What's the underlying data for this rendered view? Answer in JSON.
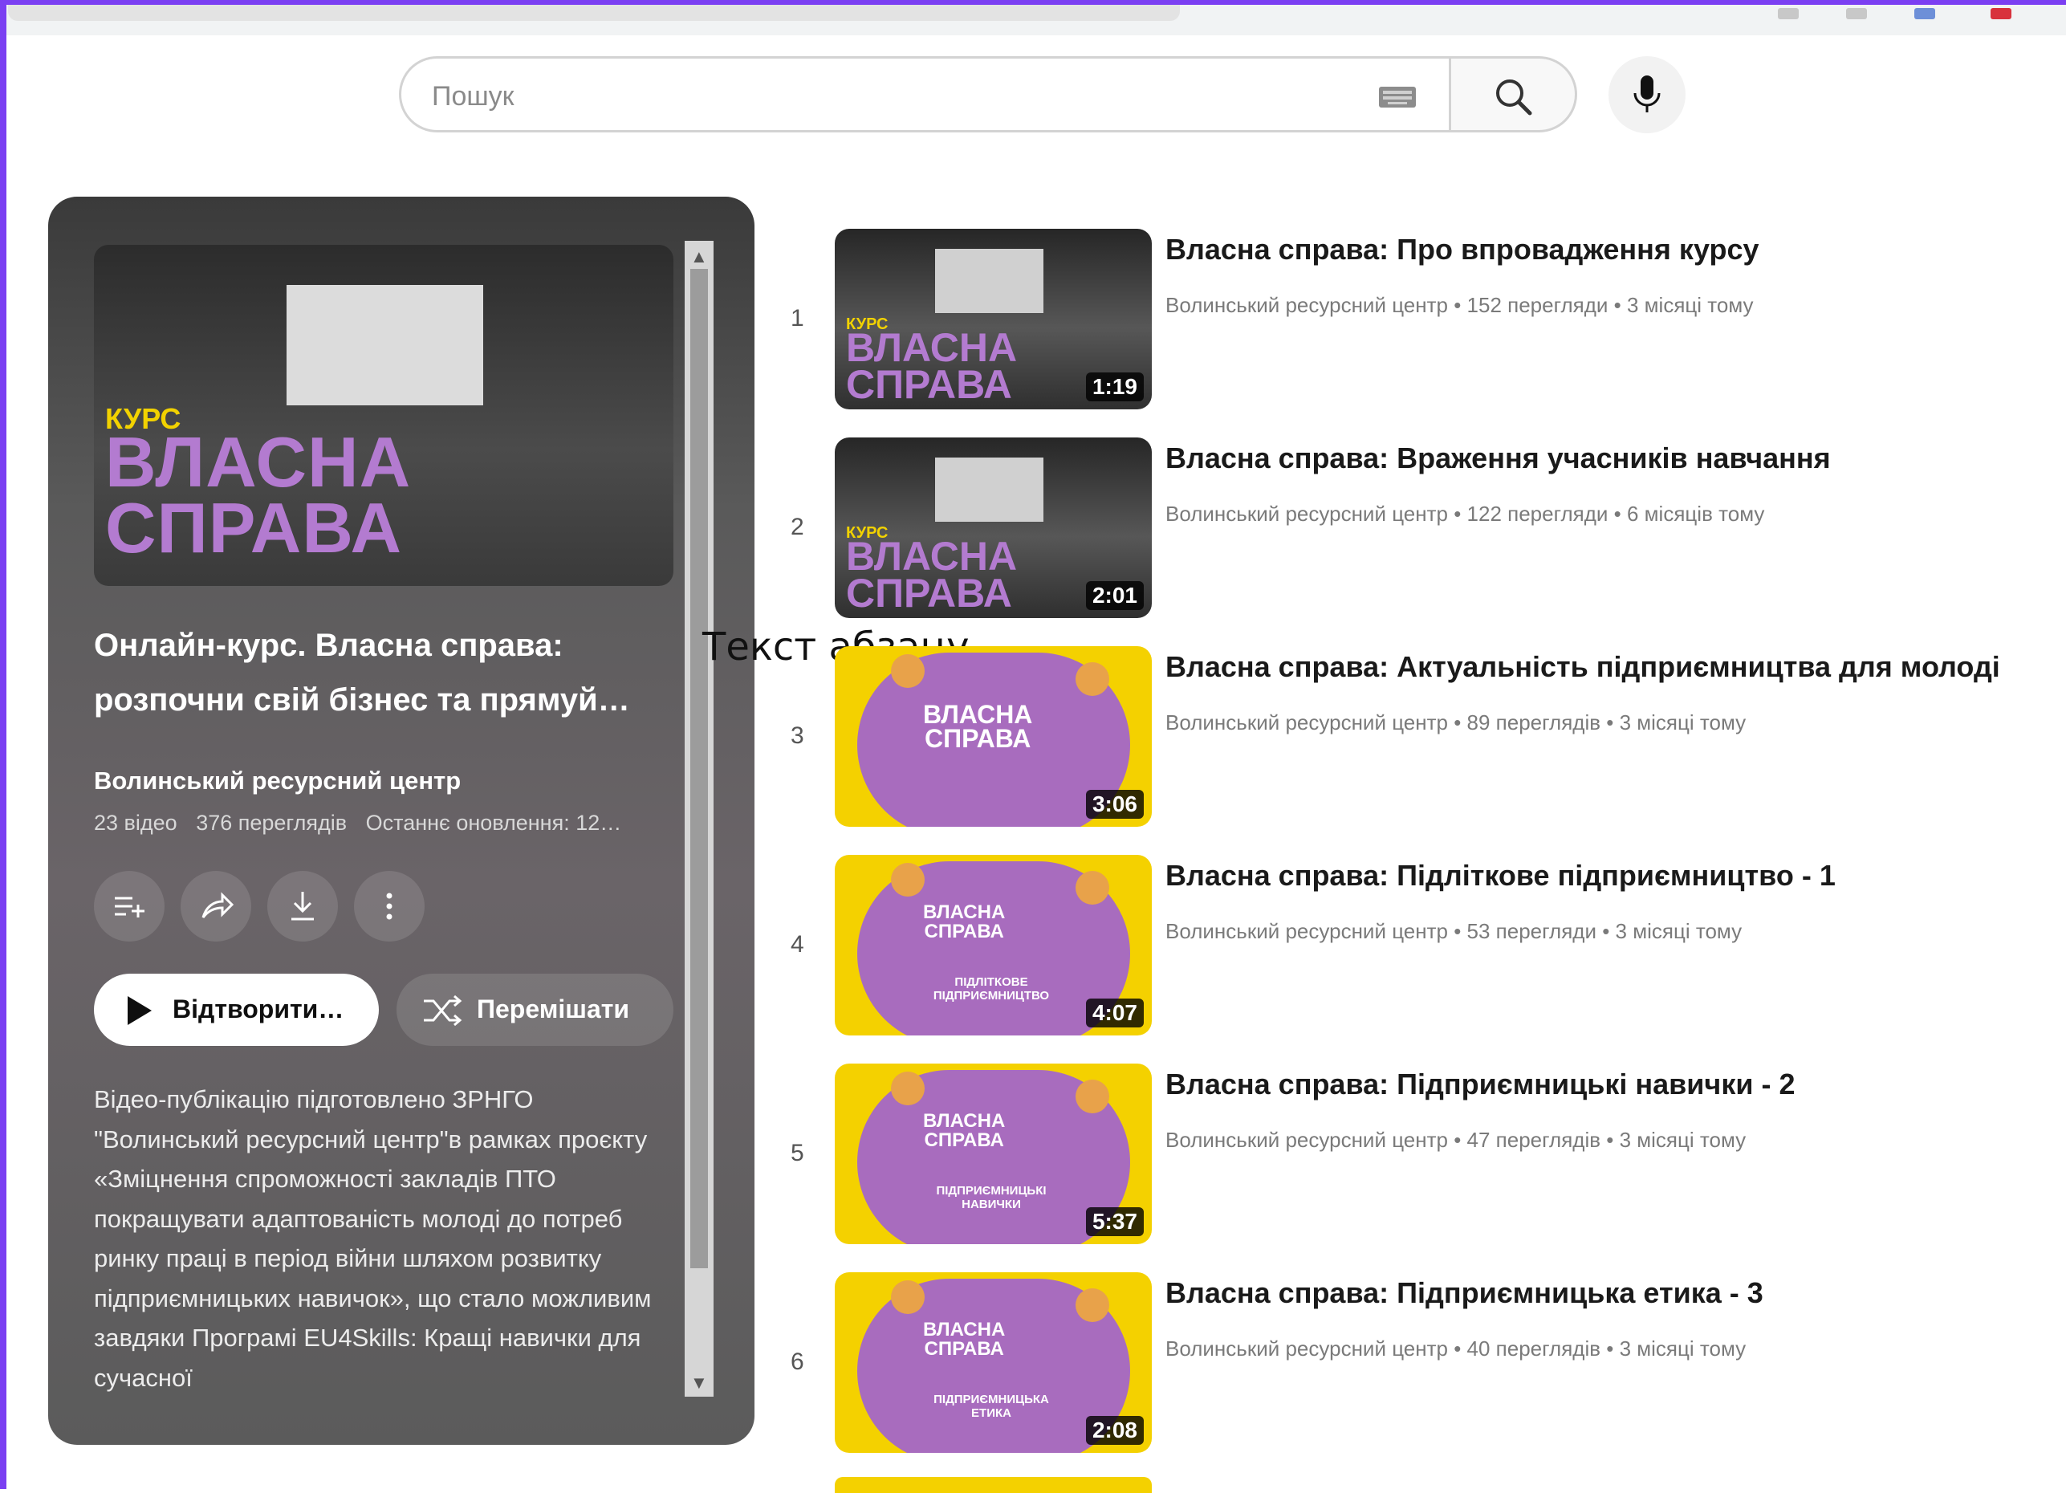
{
  "search": {
    "placeholder": "Пошук"
  },
  "playlist": {
    "thumb_kurs": "КУРС",
    "thumb_line1": "ВЛАСНА",
    "thumb_line2": "СПРАВА",
    "title_line1": "Онлайн-курс. Власна справа:",
    "title_line2": "розпочни свій бізнес та прямуй…",
    "channel": "Волинський ресурсний центр",
    "videos_count": "23 відео",
    "views": "376 переглядів",
    "updated": "Останнє оновлення: 12…",
    "play_label": "Відтворити…",
    "shuffle_label": "Перемішати",
    "description": "Відео-публікацію підготовлено ЗРНГО \"Волинський ресурсний центр\"в рамках проєкту «Зміцнення спроможності закладів ПТО покращувати адаптованість молоді до потреб ринку праці в період війни шляхом розвитку підприємницьких навичок», що стало можливим завдяки Програмі EU4Skills: Кращі навички для сучасної"
  },
  "overlay_text": "Текст абзацу",
  "videos": [
    {
      "index": "1",
      "title": "Власна справа: Про впровадження курсу",
      "meta": "Волинський ресурсний центр • 152 перегляди • 3 місяці тому",
      "duration": "1:19",
      "style": "dark",
      "thumb_kurs": "КУРС",
      "thumb_line1": "ВЛАСНА",
      "thumb_line2": "СПРАВА"
    },
    {
      "index": "2",
      "title": "Власна справа: Враження учасників навчання",
      "meta": "Волинський ресурсний центр • 122 перегляди • 6 місяців тому",
      "duration": "2:01",
      "style": "dark",
      "thumb_kurs": "КУРС",
      "thumb_line1": "ВЛАСНА",
      "thumb_line2": "СПРАВА"
    },
    {
      "index": "3",
      "title": "Власна справа: Актуальність підприємництва для молоді",
      "meta": "Волинський ресурсний центр • 89 переглядів • 3 місяці тому",
      "duration": "3:06",
      "style": "yellow",
      "thumb_line1": "ВЛАСНА",
      "thumb_line2": "СПРАВА",
      "thumb_sub": ""
    },
    {
      "index": "4",
      "title": "Власна справа: Підліткове підприємництво - 1",
      "meta": "Волинський ресурсний центр • 53 перегляди • 3 місяці тому",
      "duration": "4:07",
      "style": "yellow",
      "thumb_line1": "ВЛАСНА",
      "thumb_line2": "СПРАВА",
      "thumb_sub": "ПІДЛІТКОВЕ ПІДПРИЄМНИЦТВО"
    },
    {
      "index": "5",
      "title": "Власна справа: Підприємницькі навички - 2",
      "meta": "Волинський ресурсний центр • 47 переглядів • 3 місяці тому",
      "duration": "5:37",
      "style": "yellow",
      "thumb_line1": "ВЛАСНА",
      "thumb_line2": "СПРАВА",
      "thumb_sub": "ПІДПРИЄМНИЦЬКІ НАВИЧКИ"
    },
    {
      "index": "6",
      "title": "Власна справа: Підприємницька етика - 3",
      "meta": "Волинський ресурсний центр • 40 переглядів • 3 місяці тому",
      "duration": "2:08",
      "style": "yellow",
      "thumb_line1": "ВЛАСНА",
      "thumb_line2": "СПРАВА",
      "thumb_sub": "ПІДПРИЄМНИЦЬКА ЕТИКА"
    }
  ]
}
